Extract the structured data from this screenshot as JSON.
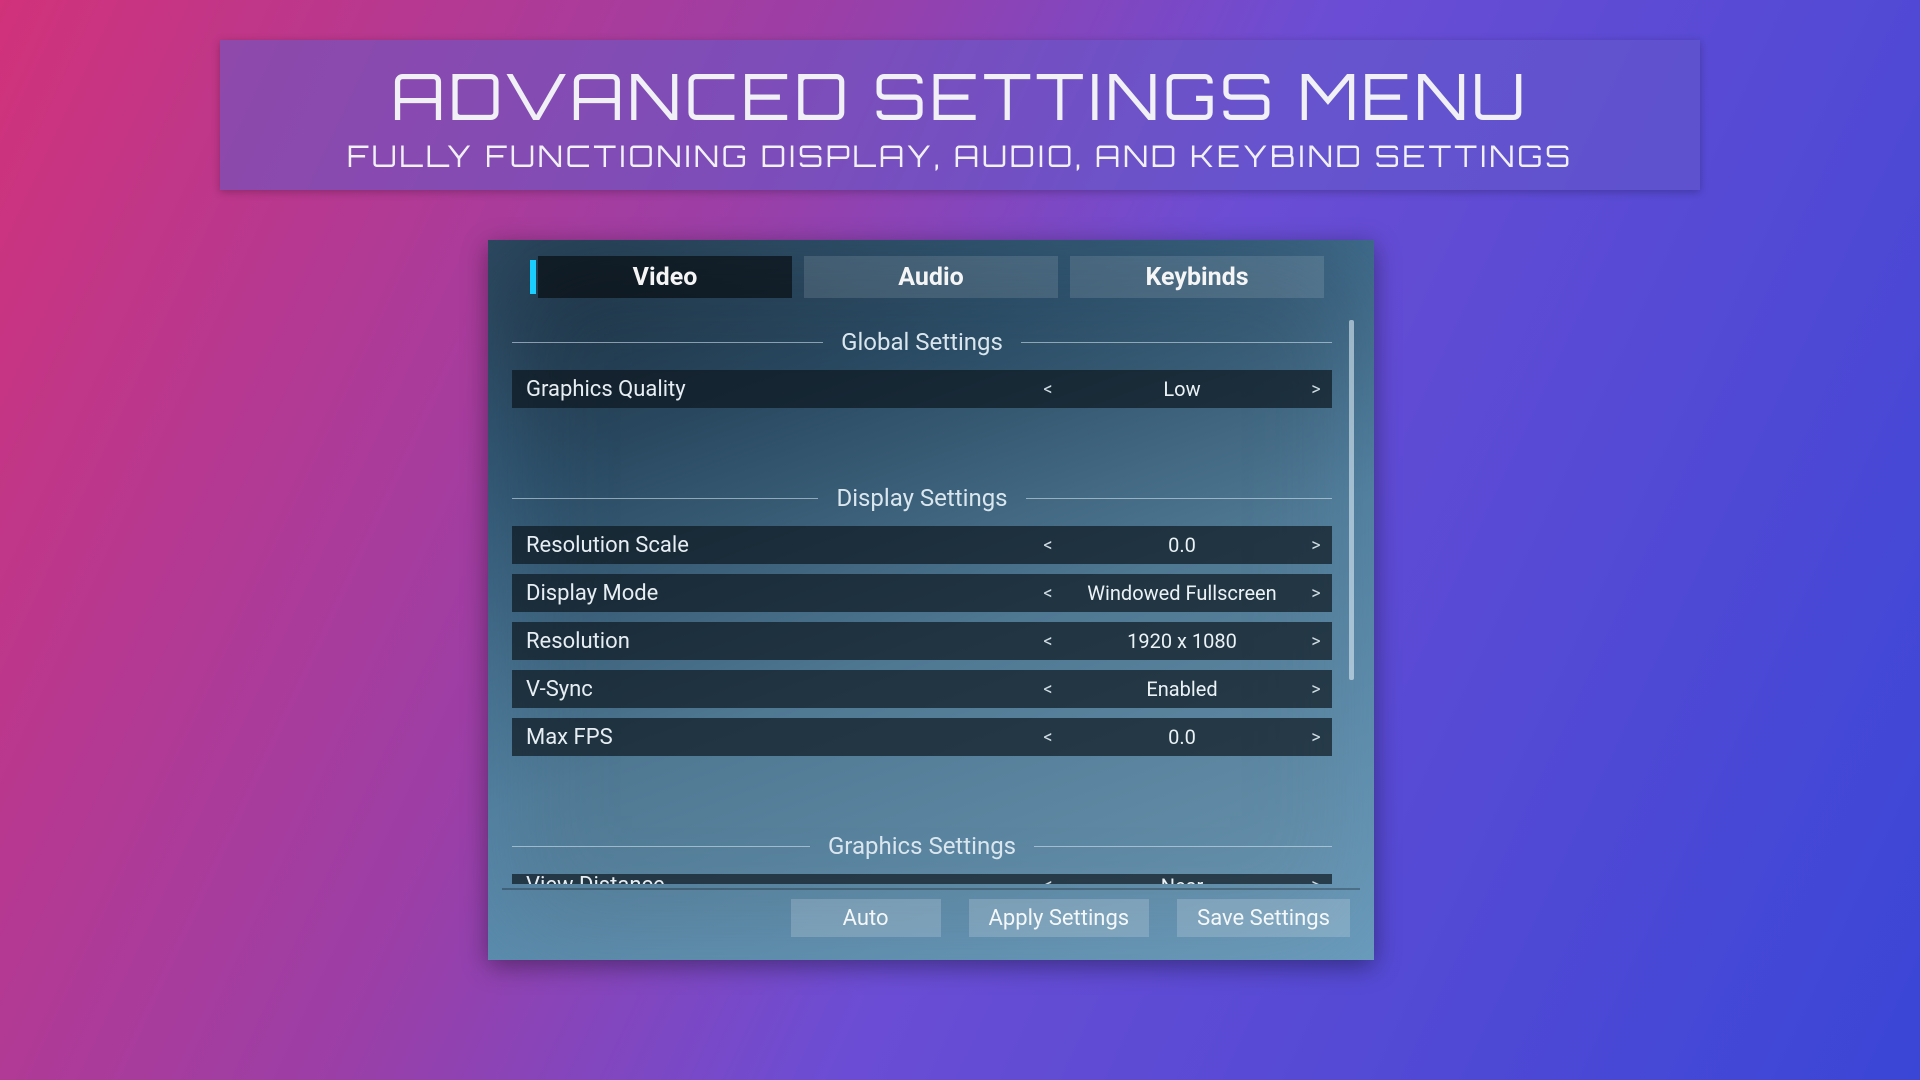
{
  "banner": {
    "title": "ADVANCED SETTINGS MENU",
    "subtitle": "FULLY FUNCTIONING DISPLAY, AUDIO, AND KEYBIND SETTINGS"
  },
  "tabs": {
    "video": "Video",
    "audio": "Audio",
    "keybinds": "Keybinds"
  },
  "sections": {
    "global": {
      "title": "Global Settings",
      "graphics_quality": {
        "label": "Graphics Quality",
        "value": "Low"
      }
    },
    "display": {
      "title": "Display Settings",
      "resolution_scale": {
        "label": "Resolution Scale",
        "value": "0.0"
      },
      "display_mode": {
        "label": "Display Mode",
        "value": "Windowed Fullscreen"
      },
      "resolution": {
        "label": "Resolution",
        "value": "1920 x 1080"
      },
      "vsync": {
        "label": "V-Sync",
        "value": "Enabled"
      },
      "max_fps": {
        "label": "Max FPS",
        "value": "0.0"
      }
    },
    "graphics": {
      "title": "Graphics Settings",
      "view_distance": {
        "label": "View Distance",
        "value": "Near"
      }
    }
  },
  "glyphs": {
    "prev": "<",
    "next": ">"
  },
  "buttons": {
    "auto": "Auto",
    "apply": "Apply Settings",
    "save": "Save Settings"
  }
}
